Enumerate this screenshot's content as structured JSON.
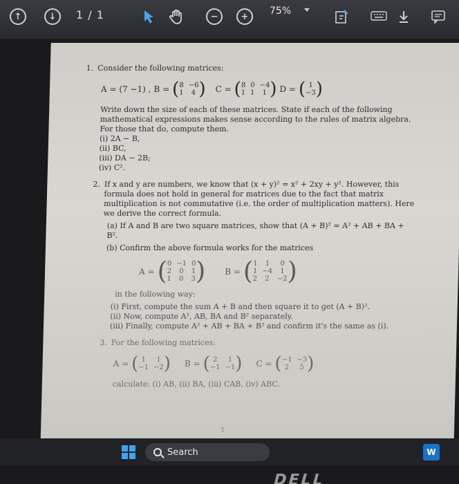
{
  "toolbar": {
    "page_counter": "1 / 1",
    "zoom": "75%",
    "icons": [
      "page-up-icon",
      "page-down-icon",
      "select-arrow-icon",
      "hand-pan-icon",
      "zoom-out-icon",
      "zoom-in-icon",
      "fit-page-icon",
      "keyboard-icon",
      "download-icon",
      "comment-icon"
    ]
  },
  "doc": {
    "q1": {
      "number": "1.",
      "intro": "Consider the following matrices:",
      "A_label": "A = (7  −1) ,",
      "B_label": "B =",
      "B": [
        [
          "8",
          "−6"
        ],
        [
          "1",
          "4"
        ]
      ],
      "C_label": "C =",
      "C": [
        [
          "8",
          "0",
          "−4"
        ],
        [
          "1",
          "1",
          "1"
        ]
      ],
      "D_label": "D =",
      "D": [
        [
          "1"
        ],
        [
          "−3"
        ]
      ],
      "text": "Write down the size of each of these matrices. State if each of the following mathematical expressions makes sense according to the rules of matrix algebra. For those that do, compute them.",
      "items": [
        "(i) 2A − B,",
        "(ii) BC,",
        "(iii) DA − 2B;",
        "(iv) C²."
      ]
    },
    "q2": {
      "number": "2.",
      "text": "If x and y are numbers, we know that (x + y)² = x² + 2xy + y². However, this formula does not hold in general for matrices due to the fact that matrix multiplication is not commutative (i.e. the order of multiplication matters). Here we derive the correct formula.",
      "part_a": "(a) If A and B are two square matrices, show that (A + B)² = A² + AB + BA + B².",
      "part_b": "(b) Confirm the above formula works for the matrices",
      "A_label": "A =",
      "A": [
        [
          "0",
          "−1",
          "0"
        ],
        [
          "2",
          "0",
          "1"
        ],
        [
          "1",
          "0",
          "3"
        ]
      ],
      "B_label": "B =",
      "B": [
        [
          "1",
          "1",
          "0"
        ],
        [
          "1",
          "−4",
          "1"
        ],
        [
          "2",
          "2",
          "−2"
        ]
      ],
      "following": "in the following way:",
      "steps": [
        "(i) First, compute the sum A + B and then square it to get (A + B)².",
        "(ii) Now, compute A², AB, BA and B² separately.",
        "(iii) Finally, compute A² + AB + BA + B² and confirm it's the same as (i)."
      ]
    },
    "q3": {
      "number": "3.",
      "intro": "For the following matrices:",
      "A_label": "A =",
      "A": [
        [
          "1",
          "1"
        ],
        [
          "−1",
          "−2"
        ]
      ],
      "B_label": "B =",
      "B": [
        [
          "2",
          "1"
        ],
        [
          "−1",
          "−1"
        ]
      ],
      "C_label": "C =",
      "C": [
        [
          "−1",
          "−3"
        ],
        [
          "2",
          "5"
        ]
      ],
      "calc": "calculate: (i) AB, (ii) BA, (iii) CAB, (iv) ABC."
    },
    "page_number": "1"
  },
  "taskbar": {
    "search_label": "Search",
    "tray_app": "W"
  },
  "logo_text": "DELL"
}
